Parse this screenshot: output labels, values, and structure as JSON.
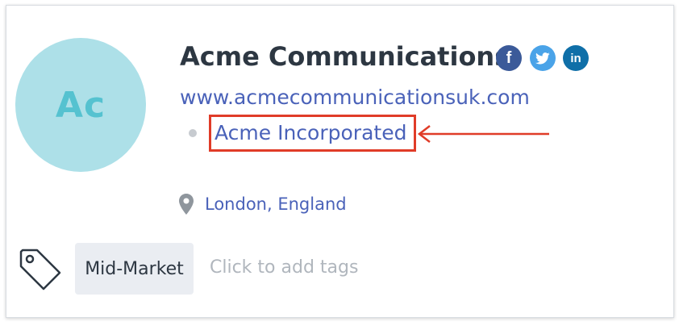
{
  "company": {
    "avatar_initials": "Ac",
    "name": "Acme Communications",
    "website": "www.acmecommunicationsuk.com",
    "parent_company": "Acme Incorporated",
    "location": "London, England"
  },
  "social": {
    "facebook_glyph": "f",
    "linkedin_glyph": "in"
  },
  "tags": {
    "items": [
      "Mid-Market"
    ],
    "add_placeholder": "Click to add tags"
  },
  "colors": {
    "avatar_bg": "#ade0e8",
    "avatar_text": "#55c2d0",
    "link": "#4a62b9",
    "highlight": "#e03c28",
    "facebook": "#3b5a99",
    "twitter": "#4aa3e8",
    "linkedin": "#0f6fa8"
  },
  "icons": [
    "facebook-icon",
    "twitter-icon",
    "linkedin-icon",
    "location-pin-icon",
    "tag-icon",
    "annotation-arrow-icon"
  ]
}
